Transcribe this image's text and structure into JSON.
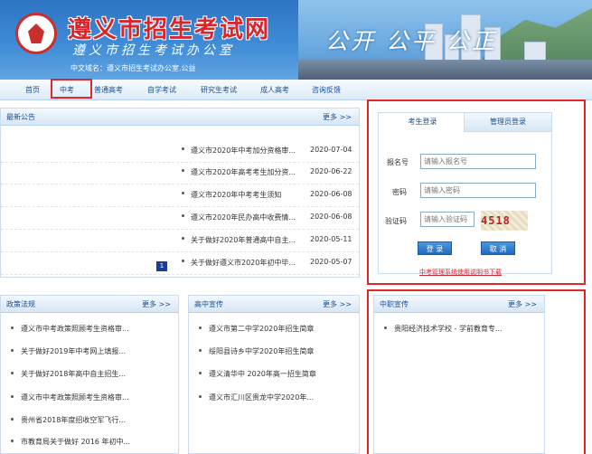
{
  "header": {
    "site_title": "遵义市招生考试网",
    "subtitle": "遵义市招生考试办公室",
    "domain_text": "中文域名：遵义市招生考试办公室.公益",
    "slogan": "公开 公平 公正"
  },
  "nav": {
    "items": [
      {
        "label": "首页"
      },
      {
        "label": "中考"
      },
      {
        "label": "普通高考"
      },
      {
        "label": "自学考试"
      },
      {
        "label": "研究生考试"
      },
      {
        "label": "成人高考"
      },
      {
        "label": "咨询反馈"
      }
    ],
    "active": "中考"
  },
  "notices": {
    "title": "最新公告",
    "more": "更多 >>",
    "page": "1",
    "items": [
      {
        "text": "遵义市2020年中考加分资格审...",
        "date": "2020-07-04"
      },
      {
        "text": "遵义市2020年高考考生加分资...",
        "date": "2020-06-22"
      },
      {
        "text": "遵义市2020年中考考生须知",
        "date": "2020-06-08"
      },
      {
        "text": "遵义市2020年民办高中收费情...",
        "date": "2020-06-08"
      },
      {
        "text": "关于做好2020年普通高中自主...",
        "date": "2020-05-11"
      },
      {
        "text": "关于做好遵义市2020年初中毕...",
        "date": "2020-05-07"
      }
    ]
  },
  "login": {
    "tab_student": "考生登录",
    "tab_admin": "管理员登录",
    "label_id": "报名号",
    "label_password": "密码",
    "label_captcha": "验证码",
    "id_placeholder": "请输入报名号",
    "password_placeholder": "请输入密码",
    "captcha_placeholder": "请输入验证码",
    "captcha_code": "4518",
    "login_button": "登 录",
    "cancel_button": "取 消",
    "manual_link": "中考管理系统使用说明书下载"
  },
  "policy": {
    "title": "政策法规",
    "more": "更多 >>",
    "items": [
      "遵义市中考政策照顾考生资格审...",
      "关于做好2019年中考网上填报...",
      "关于做好2018年高中自主招生...",
      "遵义市中考政策照顾考生资格审...",
      "贵州省2018年度招收空军飞行...",
      "市教育局关于做好 2016 年初中..."
    ]
  },
  "highschool": {
    "title": "高中宣传",
    "more": "更多 >>",
    "items": [
      "遵义市第二中学2020年招生简章",
      "绥阳县诗乡中学2020年招生简章",
      "遵义清华中 2020年高一招生简章",
      "遵义市汇川区贵龙中学2020年..."
    ]
  },
  "vocational": {
    "title": "中职宣传",
    "more": "更多 >>",
    "items": [
      "贵阳经济技术学校 - 学前教育专..."
    ]
  }
}
